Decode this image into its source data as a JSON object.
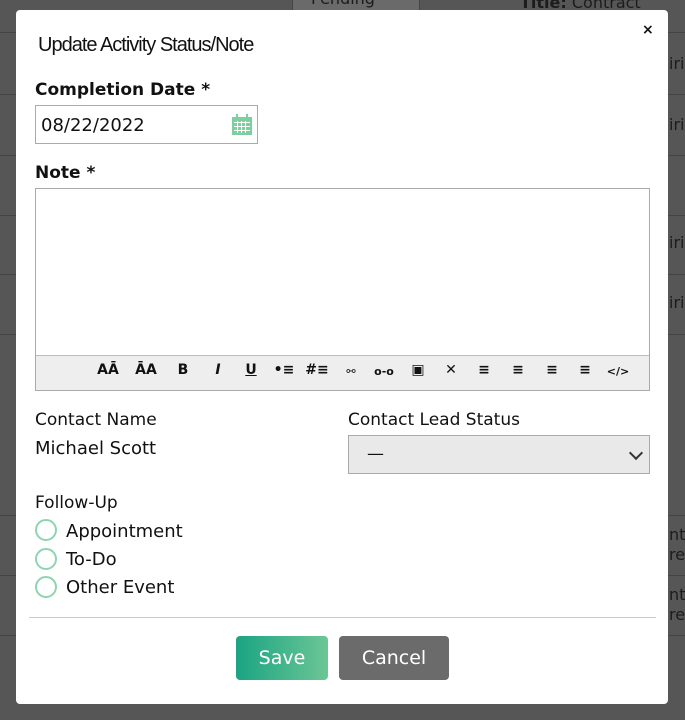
{
  "background": {
    "status_select": "Pending",
    "title_label": "Title:",
    "title_value": "Contract expiri",
    "row_fragments": [
      "iri",
      "iri",
      "iri",
      "iri",
      "nt",
      "re",
      "nt",
      "re"
    ]
  },
  "modal": {
    "title": "Update Activity Status/Note",
    "close_label": "×",
    "completion_date": {
      "label": "Completion Date *",
      "value": "08/22/2022",
      "icon": "calendar-icon"
    },
    "note": {
      "label": "Note *",
      "value": "",
      "toolbar": [
        {
          "name": "font-size-decrease",
          "glyph": "AĀ"
        },
        {
          "name": "font-size-increase",
          "glyph": "ĀA"
        },
        {
          "name": "bold",
          "glyph": "B"
        },
        {
          "name": "italic",
          "glyph": "I"
        },
        {
          "name": "underline",
          "glyph": "U"
        },
        {
          "name": "bullet-list",
          "glyph": "•≡"
        },
        {
          "name": "numbered-list",
          "glyph": "#≡"
        },
        {
          "name": "link",
          "glyph": "⚯"
        },
        {
          "name": "unlink",
          "glyph": "o-o"
        },
        {
          "name": "image",
          "glyph": "▣"
        },
        {
          "name": "remove-format",
          "glyph": "✕"
        },
        {
          "name": "align-left",
          "glyph": "≡"
        },
        {
          "name": "align-center",
          "glyph": "≡"
        },
        {
          "name": "align-right",
          "glyph": "≡"
        },
        {
          "name": "justify",
          "glyph": "≡"
        },
        {
          "name": "source-code",
          "glyph": "</>"
        }
      ]
    },
    "contact_name": {
      "label": "Contact Name",
      "value": "Michael Scott"
    },
    "contact_lead_status": {
      "label": "Contact Lead Status",
      "value": "—"
    },
    "follow_up": {
      "label": "Follow-Up",
      "options": [
        "Appointment",
        "To-Do",
        "Other Event"
      ]
    },
    "save_label": "Save",
    "cancel_label": "Cancel",
    "colors": {
      "accent": "#1aa483",
      "radio": "#8fd4b0",
      "cancel": "#6b6b6b"
    }
  }
}
